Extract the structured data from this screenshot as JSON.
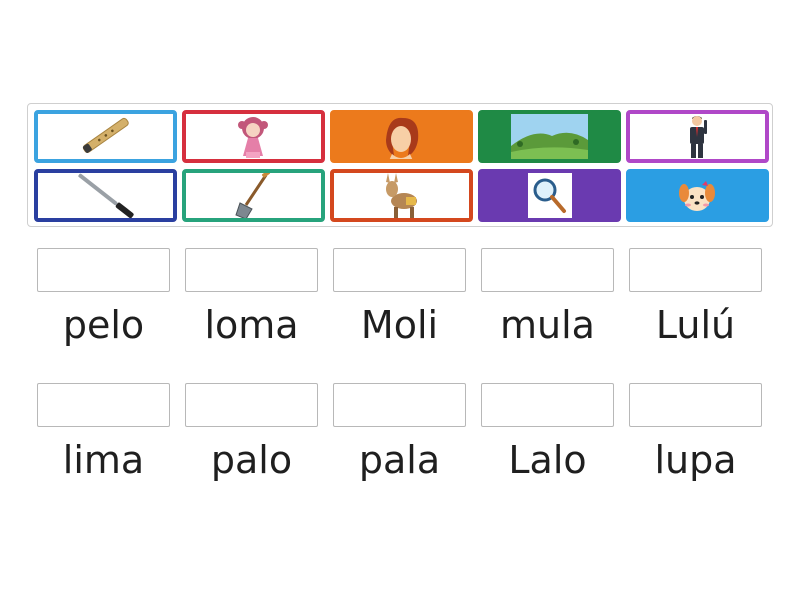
{
  "tiles": [
    {
      "id": "flute",
      "icon": "flute-icon",
      "border": "#3ba3e0",
      "fill": "#ffffff"
    },
    {
      "id": "doll",
      "icon": "doll-icon",
      "border": "#d62f3e",
      "fill": "#ffffff"
    },
    {
      "id": "hair",
      "icon": "hair-icon",
      "border": "#ec7a1c",
      "fill": "#ec7a1c"
    },
    {
      "id": "hill",
      "icon": "hill-landscape-icon",
      "border": "#1f8a45",
      "fill": "#1f8a45"
    },
    {
      "id": "man",
      "icon": "man-icon",
      "border": "#b048c8",
      "fill": "#ffffff"
    },
    {
      "id": "file",
      "icon": "nail-file-icon",
      "border": "#2a3fa0",
      "fill": "#ffffff"
    },
    {
      "id": "shovel",
      "icon": "shovel-icon",
      "border": "#27a37c",
      "fill": "#ffffff"
    },
    {
      "id": "donkey",
      "icon": "donkey-icon",
      "border": "#d4481e",
      "fill": "#ffffff"
    },
    {
      "id": "magnifier",
      "icon": "magnifier-icon",
      "border": "#6a3ab0",
      "fill": "#6a3ab0"
    },
    {
      "id": "puppy",
      "icon": "puppy-icon",
      "border": "#2b9ee3",
      "fill": "#2b9ee3"
    }
  ],
  "words": [
    "pelo",
    "loma",
    "Moli",
    "mula",
    "Lulú",
    "lima",
    "palo",
    "pala",
    "Lalo",
    "lupa"
  ]
}
